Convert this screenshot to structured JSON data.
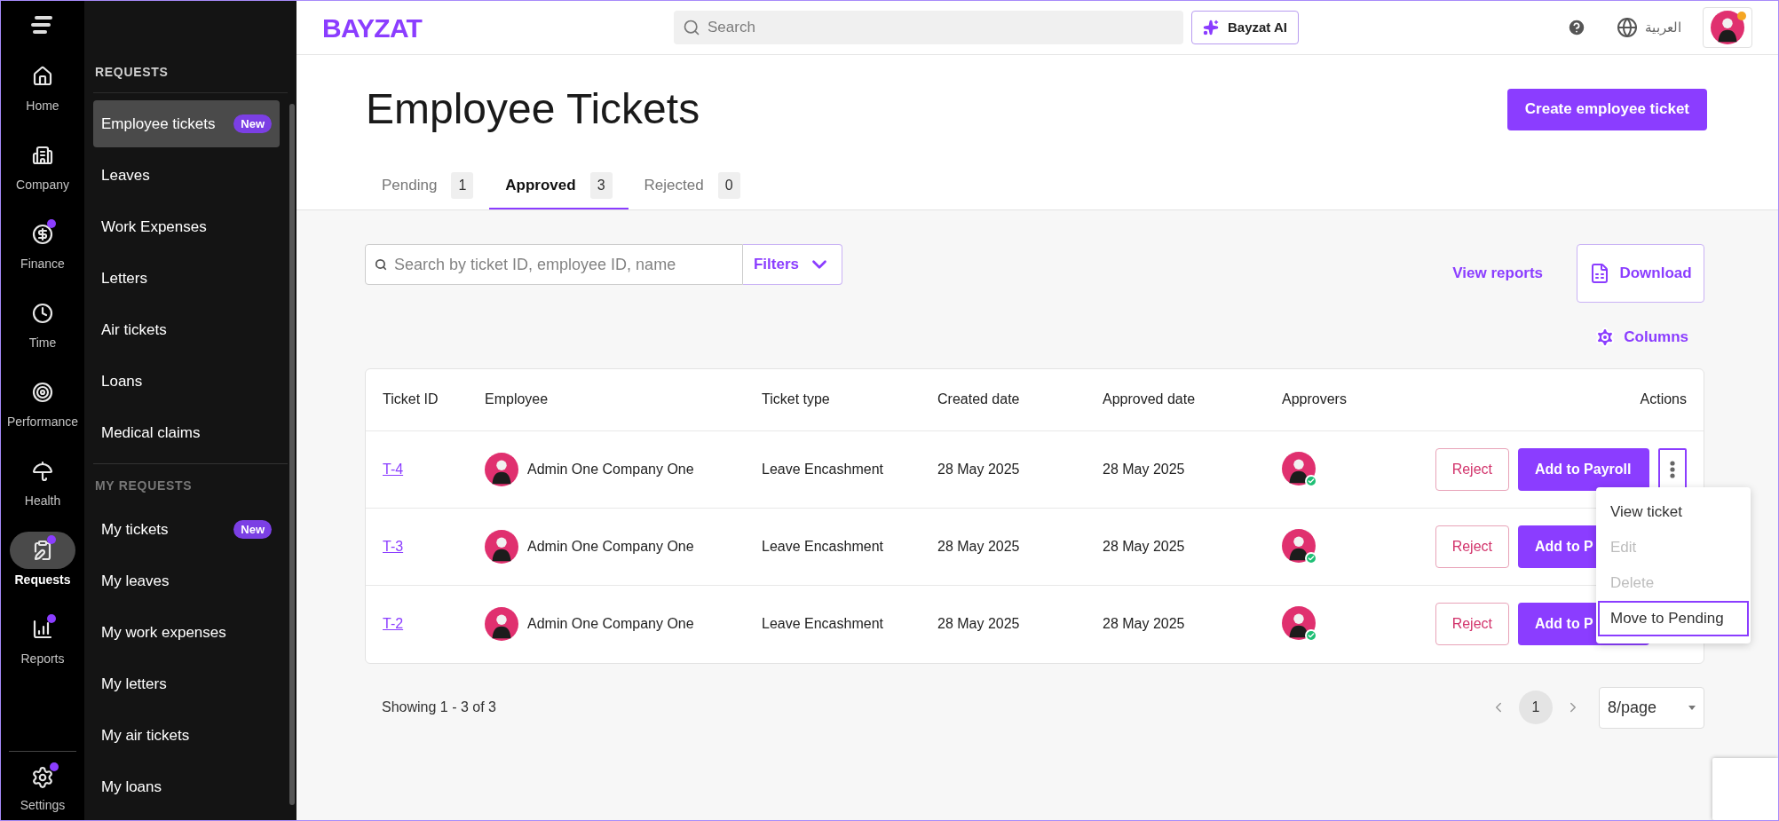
{
  "rail": {
    "items": [
      {
        "label": "Home",
        "selected": false,
        "dot": false
      },
      {
        "label": "Company",
        "selected": false,
        "dot": false
      },
      {
        "label": "Finance",
        "selected": false,
        "dot": true
      },
      {
        "label": "Time",
        "selected": false,
        "dot": false
      },
      {
        "label": "Performance",
        "selected": false,
        "dot": false
      },
      {
        "label": "Health",
        "selected": false,
        "dot": false
      },
      {
        "label": "Requests",
        "selected": true,
        "dot": true
      },
      {
        "label": "Reports",
        "selected": false,
        "dot": true
      }
    ],
    "settings": {
      "label": "Settings",
      "dot": true
    }
  },
  "sidebar": {
    "sections": [
      {
        "heading": "REQUESTS",
        "items": [
          {
            "label": "Employee tickets",
            "selected": true,
            "badge": "New"
          },
          {
            "label": "Leaves",
            "selected": false
          },
          {
            "label": "Work Expenses",
            "selected": false
          },
          {
            "label": "Letters",
            "selected": false
          },
          {
            "label": "Air tickets",
            "selected": false
          },
          {
            "label": "Loans",
            "selected": false
          },
          {
            "label": "Medical claims",
            "selected": false
          }
        ]
      },
      {
        "heading": "MY REQUESTS",
        "items": [
          {
            "label": "My tickets",
            "selected": false,
            "badge": "New"
          },
          {
            "label": "My leaves",
            "selected": false
          },
          {
            "label": "My work expenses",
            "selected": false
          },
          {
            "label": "My letters",
            "selected": false
          },
          {
            "label": "My air tickets",
            "selected": false
          },
          {
            "label": "My loans",
            "selected": false
          }
        ]
      }
    ]
  },
  "topbar": {
    "logo": "BAYZAT",
    "search": {
      "placeholder": "Search"
    },
    "ai_button": "Bayzat AI",
    "language": "العربية",
    "avatar_dot": true
  },
  "page": {
    "title": "Employee Tickets",
    "create_button": "Create employee ticket"
  },
  "tabs": [
    {
      "label": "Pending",
      "count": "1",
      "selected": false
    },
    {
      "label": "Approved",
      "count": "3",
      "selected": true
    },
    {
      "label": "Rejected",
      "count": "0",
      "selected": false
    }
  ],
  "toolbar": {
    "search": {
      "placeholder": "Search by ticket ID, employee ID, name"
    },
    "filters": "Filters",
    "view_reports": "View reports",
    "download": "Download",
    "columns": "Columns"
  },
  "table": {
    "columns": [
      "Ticket ID",
      "Employee",
      "Ticket type",
      "Created date",
      "Approved date",
      "Approvers",
      "Actions"
    ],
    "rows": [
      {
        "ticket_id": "T-4",
        "employee": "Admin One Company One",
        "ticket_type": "Leave Encashment",
        "created": "28 May 2025",
        "approved": "28 May 2025",
        "reject": "Reject",
        "payroll": "Add to Payroll"
      },
      {
        "ticket_id": "T-3",
        "employee": "Admin One Company One",
        "ticket_type": "Leave Encashment",
        "created": "28 May 2025",
        "approved": "28 May 2025",
        "reject": "Reject",
        "payroll": "Add to P"
      },
      {
        "ticket_id": "T-2",
        "employee": "Admin One Company One",
        "ticket_type": "Leave Encashment",
        "created": "28 May 2025",
        "approved": "28 May 2025",
        "reject": "Reject",
        "payroll": "Add to P"
      }
    ]
  },
  "row_menu": {
    "open": true,
    "items": [
      {
        "label": "View ticket",
        "disabled": false,
        "selected": false
      },
      {
        "label": "Edit",
        "disabled": true,
        "selected": false
      },
      {
        "label": "Delete",
        "disabled": true,
        "selected": false
      },
      {
        "label": "Move to Pending",
        "disabled": false,
        "selected": true
      }
    ]
  },
  "pagination": {
    "summary": "Showing 1 - 3 of 3",
    "pages": [
      {
        "label": "1",
        "selected": true
      }
    ],
    "page_size": "8/page"
  }
}
